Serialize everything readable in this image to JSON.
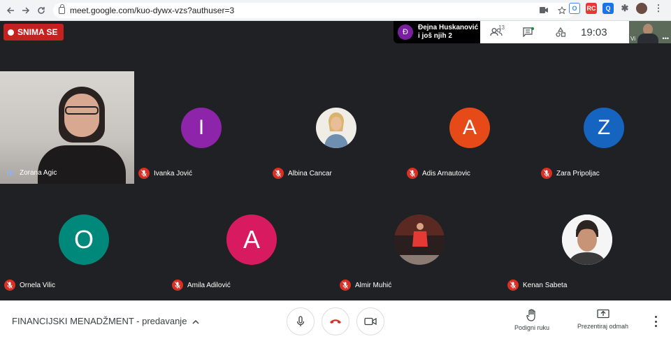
{
  "browser": {
    "url": "meet.google.com/kuo-dywx-vzs?authuser=3"
  },
  "meet": {
    "recording_label": "SNIMA SE",
    "notification": {
      "avatar_letter": "Đ",
      "line1": "Đejna Huskanović",
      "line2": "i još njih 2"
    },
    "participants_count": "13",
    "time": "19:03",
    "self_view_label": "Vi"
  },
  "participants": [
    {
      "name": "Zorana Agic",
      "type": "video"
    },
    {
      "name": "Ivanka Jović",
      "type": "letter",
      "letter": "I",
      "color": "#8e24aa"
    },
    {
      "name": "Albina Cancar",
      "type": "photo"
    },
    {
      "name": "Adis Arnautovic",
      "type": "letter",
      "letter": "A",
      "color": "#e64a19"
    },
    {
      "name": "Zara Pripoljac",
      "type": "letter",
      "letter": "Z",
      "color": "#1565c0"
    },
    {
      "name": "Ornela Vilic",
      "type": "letter",
      "letter": "O",
      "color": "#00897b"
    },
    {
      "name": "Amila Adilović",
      "type": "letter",
      "letter": "A",
      "color": "#d81b60"
    },
    {
      "name": "Almir Muhić",
      "type": "photo"
    },
    {
      "name": "Kenan Sabeta",
      "type": "photo"
    }
  ],
  "bottom_bar": {
    "meeting_title": "FINANCIJSKI MENADŽMENT - predavanje",
    "raise_hand_label": "Podigni ruku",
    "present_label": "Prezentiraj odmah"
  }
}
